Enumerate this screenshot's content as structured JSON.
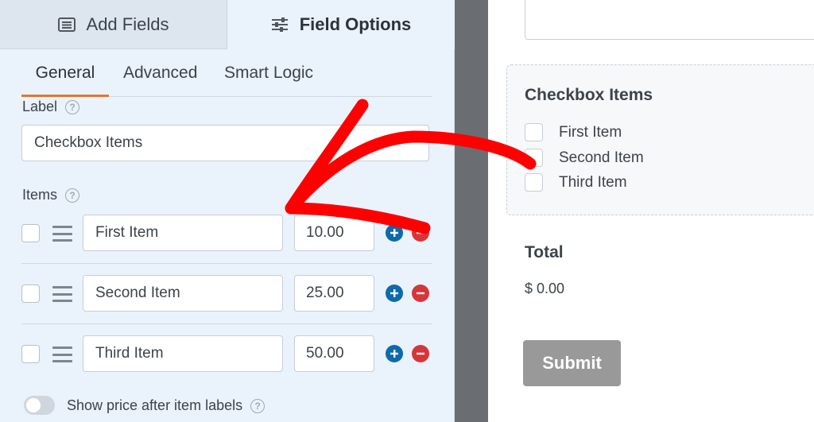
{
  "tabs": {
    "add_fields": "Add Fields",
    "field_options": "Field Options"
  },
  "subtabs": {
    "general": "General",
    "advanced": "Advanced",
    "smart_logic": "Smart Logic"
  },
  "field": {
    "label_title": "Label",
    "label_value": "Checkbox Items",
    "items_title": "Items",
    "help_symbol": "?"
  },
  "items": [
    {
      "name": "First Item",
      "price": "10.00"
    },
    {
      "name": "Second Item",
      "price": "25.00"
    },
    {
      "name": "Third Item",
      "price": "50.00"
    }
  ],
  "show_price_label": "Show price after item labels",
  "preview": {
    "title": "Checkbox Items",
    "options": [
      "First Item",
      "Second Item",
      "Third Item"
    ],
    "total_label": "Total",
    "total_value": "$ 0.00",
    "submit_label": "Submit"
  },
  "colors": {
    "accent_tab": "#e27730",
    "plus": "#0e6aab",
    "minus": "#d63638",
    "arrow": "#ff0000",
    "submit": "#999999"
  },
  "icons": {
    "add_fields": "form-list-icon",
    "field_options": "sliders-icon",
    "help": "question-circle-icon",
    "drag": "drag-handle-icon",
    "add": "plus-circle-icon",
    "remove": "minus-circle-icon"
  }
}
